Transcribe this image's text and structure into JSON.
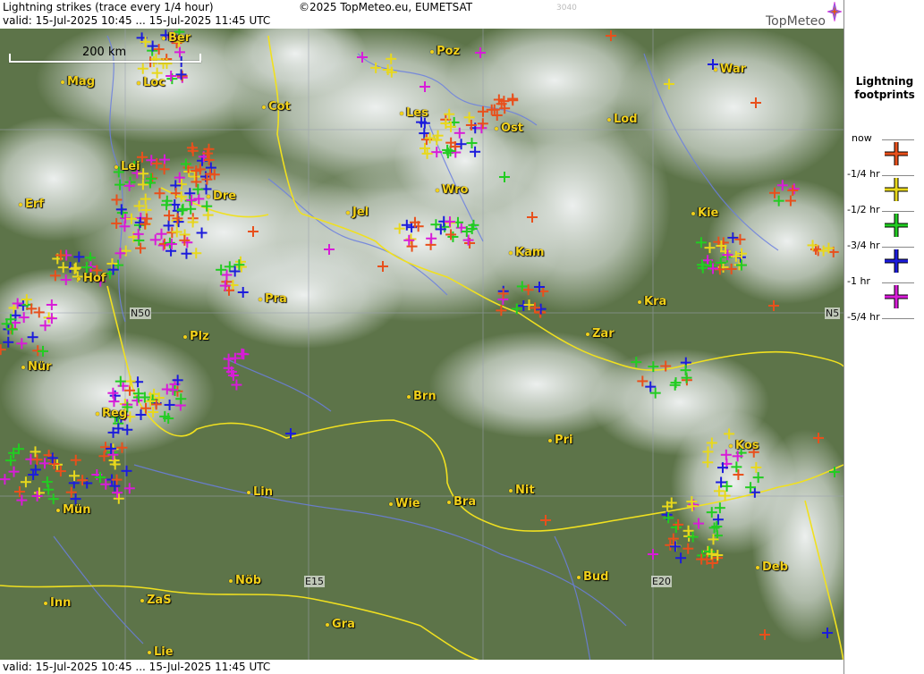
{
  "header": {
    "title": "Lightning strikes (trace every 1/4 hour)",
    "copyright": "©2025 TopMeteo.eu, EUMETSAT",
    "valid_top": "valid:  15-Jul-2025 10:45 ... 15-Jul-2025 11:45 UTC",
    "valid_bottom": "valid:  15-Jul-2025 10:45 ... 15-Jul-2025 11:45 UTC",
    "faint_code": "3040"
  },
  "logo": {
    "text": "TopMeteo"
  },
  "scale_bar": {
    "label": "200 km"
  },
  "grid_labels": {
    "n50": "N50",
    "n50_right": "N5",
    "e15": "E15",
    "e20": "E20"
  },
  "cities": [
    "Ber",
    "Poz",
    "War",
    "Mag",
    "Loc",
    "Cot",
    "Les",
    "Ost",
    "Lod",
    "Lei",
    "Dre",
    "Erf",
    "Wro",
    "Jel",
    "Kie",
    "Kam",
    "Hof",
    "Pra",
    "Kra",
    "Plz",
    "Zar",
    "Nür",
    "Brn",
    "Reg",
    "Pri",
    "Kos",
    "Lin",
    "Nit",
    "Mün",
    "Wie",
    "Bra",
    "Inn",
    "ZaS",
    "Nöb",
    "Bud",
    "Deb",
    "Gra",
    "Lie"
  ],
  "legend": {
    "title_line1": "Lightning",
    "title_line2": "footprints",
    "items": [
      {
        "label": "now",
        "color": "#e8501c"
      },
      {
        "label": "-1/4 hr",
        "color": "#e8d81c"
      },
      {
        "label": "-1/2 hr",
        "color": "#22cc22"
      },
      {
        "label": "-3/4 hr",
        "color": "#1c1cdc"
      },
      {
        "label": "-1 hr",
        "color": "#d81cd8"
      },
      {
        "label": "-5/4 hr",
        "color": ""
      }
    ]
  },
  "colors": {
    "river": "#6b7fe0",
    "border": "#f0e020",
    "land": "#4e6a3c",
    "city": "#f2d11a"
  }
}
